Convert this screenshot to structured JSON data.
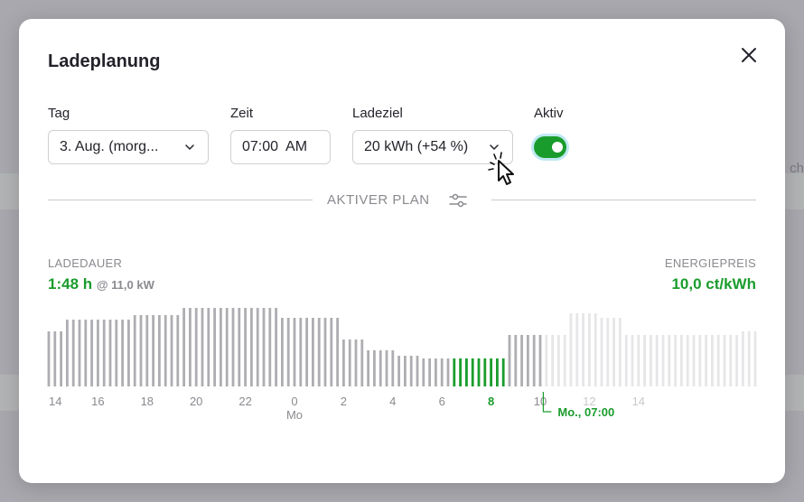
{
  "modal": {
    "title": "Ladeplanung",
    "close_icon": "close-icon"
  },
  "form": {
    "day": {
      "label": "Tag",
      "value": "3. Aug. (morg..."
    },
    "time": {
      "label": "Zeit",
      "value": "07:00  AM"
    },
    "target": {
      "label": "Ladeziel",
      "value": "20 kWh (+54 %)"
    },
    "active": {
      "label": "Aktiv",
      "on": true
    }
  },
  "plan": {
    "section_title": "AKTIVER PLAN",
    "settings_icon": "sliders-icon"
  },
  "stats": {
    "duration_label": "LADEDAUER",
    "duration_value": "1:48 h",
    "duration_power": "@ 11,0 kW",
    "price_label": "ENERGIEPREIS",
    "price_value": "10,0 ct/kWh"
  },
  "background": {
    "partial_text": "ch",
    "footer_text": "..."
  },
  "colors": {
    "accent": "#1a9c2c",
    "bar_past": "#aeaeb2",
    "bar_future": "#e6e6e8",
    "bar_active": "#1a9c2c",
    "toggle_ring": "#bfe9f2"
  },
  "chart_data": {
    "type": "bar",
    "title": "",
    "xlabel": "",
    "ylabel": "",
    "ylim": [
      0,
      10
    ],
    "tick_labels": [
      "14",
      "16",
      "18",
      "20",
      "22",
      "0",
      "2",
      "4",
      "6",
      "8",
      "10",
      "12",
      "14"
    ],
    "day_label": "Mo",
    "marker_label": "Mo., 07:00",
    "series": [
      {
        "status": "past",
        "values": [
          6.1,
          6.1,
          6.1,
          7.4,
          7.4,
          7.4,
          7.4,
          7.4,
          7.4,
          7.4,
          7.4,
          7.4,
          7.4,
          7.4,
          7.9,
          7.9,
          7.9,
          7.9,
          7.9,
          7.9,
          7.9,
          7.9,
          8.7,
          8.7,
          8.7,
          8.7,
          8.7,
          8.7,
          8.7,
          8.7,
          8.7,
          8.7,
          8.7,
          8.7,
          8.7,
          8.7,
          8.7,
          8.7,
          7.6,
          7.6,
          7.6,
          7.6,
          7.6,
          7.6,
          7.6,
          7.6,
          7.6,
          7.6,
          5.2,
          5.2,
          5.2,
          5.2,
          4.0,
          4.0,
          4.0,
          4.0,
          4.0,
          3.4,
          3.4,
          3.4,
          3.4,
          3.1,
          3.1,
          3.1,
          3.1,
          3.1
        ]
      },
      {
        "status": "charging",
        "values": [
          3.1,
          3.1,
          3.1,
          3.1,
          3.1,
          3.1,
          3.1,
          3.1,
          3.1
        ]
      },
      {
        "status": "future_before_target",
        "values": [
          5.7,
          5.7,
          5.7,
          5.7,
          5.7,
          5.7
        ]
      },
      {
        "status": "future_after_target",
        "values": [
          5.7,
          5.7,
          5.7,
          5.7,
          8.1,
          8.1,
          8.1,
          8.1,
          8.1,
          7.6,
          7.6,
          7.6,
          7.6,
          5.7,
          5.7,
          5.7,
          5.7,
          5.7,
          5.7,
          5.7,
          5.7,
          5.7,
          5.7,
          5.7,
          5.7,
          5.7,
          5.7,
          5.7,
          5.7,
          5.7,
          5.7,
          5.7,
          6.1,
          6.1,
          6.1
        ]
      }
    ]
  }
}
